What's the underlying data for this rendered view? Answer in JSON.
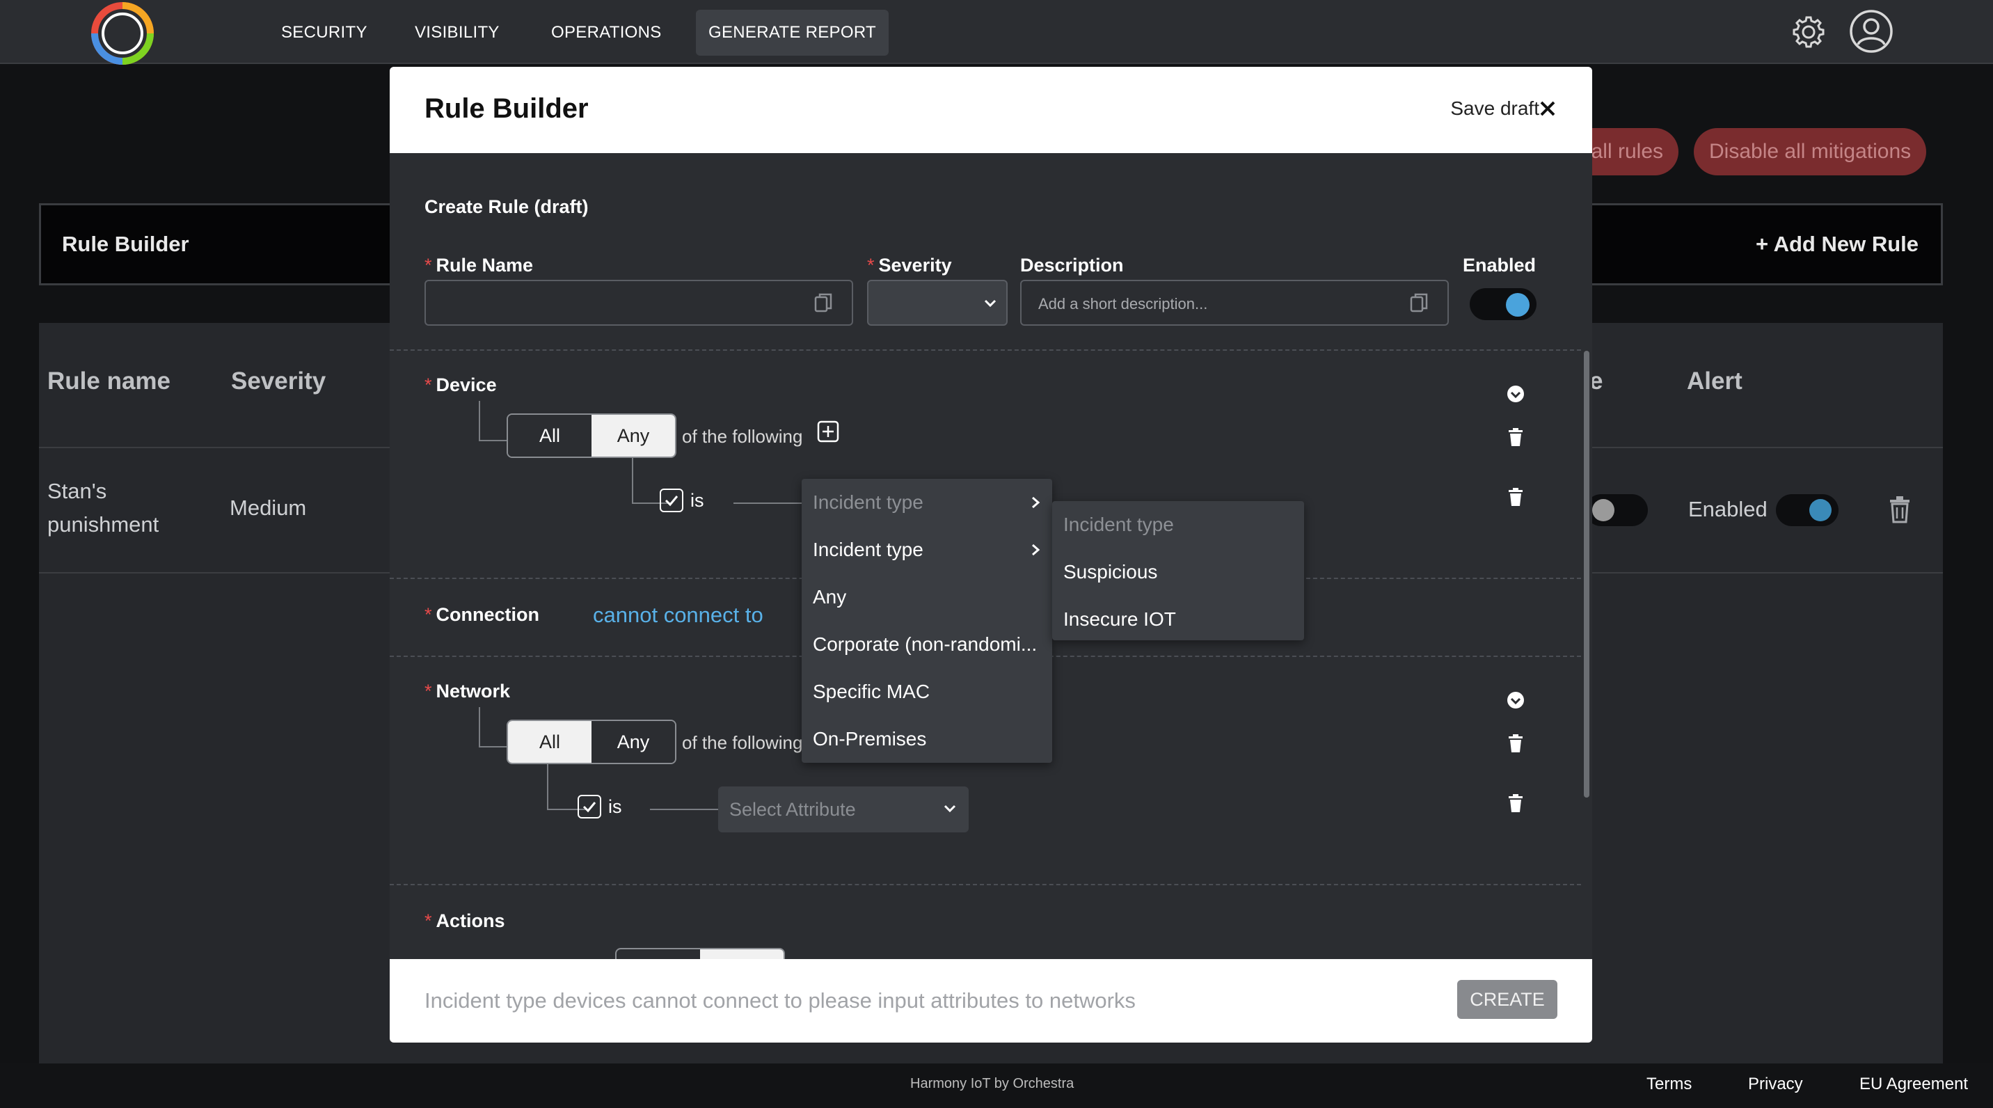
{
  "nav": {
    "items": [
      "SECURITY",
      "VISIBILITY",
      "OPERATIONS",
      "GENERATE REPORT"
    ],
    "active_index": 3,
    "icons": [
      "gear-icon",
      "user-account-icon"
    ]
  },
  "background": {
    "buttons": {
      "enable_all_rules": "all rules",
      "disable_all_mitigations": "Disable all mitigations"
    },
    "page_title": "Rule Builder",
    "add_rule": "+ Add New Rule",
    "columns": {
      "rule_name": "Rule name",
      "severity": "Severity",
      "partial": "e",
      "alert": "Alert"
    },
    "row": {
      "name_line1": "Stan's",
      "name_line2": "punishment",
      "severity": "Medium",
      "alert_status": "Enabled"
    }
  },
  "modal": {
    "title": "Rule Builder",
    "save_draft": "Save draft",
    "subtitle": "Create Rule (draft)",
    "fields": {
      "rule_name_label": "Rule Name",
      "severity_label": "Severity",
      "description_label": "Description",
      "description_placeholder": "Add a short description...",
      "enabled_label": "Enabled",
      "required_mark": "*"
    },
    "device": {
      "label": "Device",
      "all": "All",
      "any": "Any",
      "active": "Any",
      "of_following": "of the following",
      "is": "is"
    },
    "connection": {
      "label": "Connection",
      "value": "cannot connect to"
    },
    "network": {
      "label": "Network",
      "all": "All",
      "any": "Any",
      "active": "All",
      "of_following": "of the following",
      "is": "is",
      "select_placeholder": "Select Attribute"
    },
    "actions": {
      "label": "Actions"
    },
    "dropdown_primary": {
      "header": "Incident type",
      "items": [
        "Incident type",
        "Any",
        "Corporate (non-randomi...",
        "Specific MAC",
        "On-Premises"
      ]
    },
    "dropdown_secondary": {
      "header": "Incident type",
      "items": [
        "Suspicious",
        "Insecure IOT"
      ]
    },
    "summary": "Incident type devices cannot connect to please input attributes to networks",
    "create": "CREATE"
  },
  "footer": {
    "center": "Harmony IoT by Orchestra",
    "links": [
      "Terms",
      "Privacy",
      "EU Agreement"
    ]
  },
  "colors": {
    "accent_blue": "#4aa3dc",
    "link_blue": "#59b1e8",
    "danger_red": "#7a2c2e",
    "required_red": "#e64a4a"
  }
}
